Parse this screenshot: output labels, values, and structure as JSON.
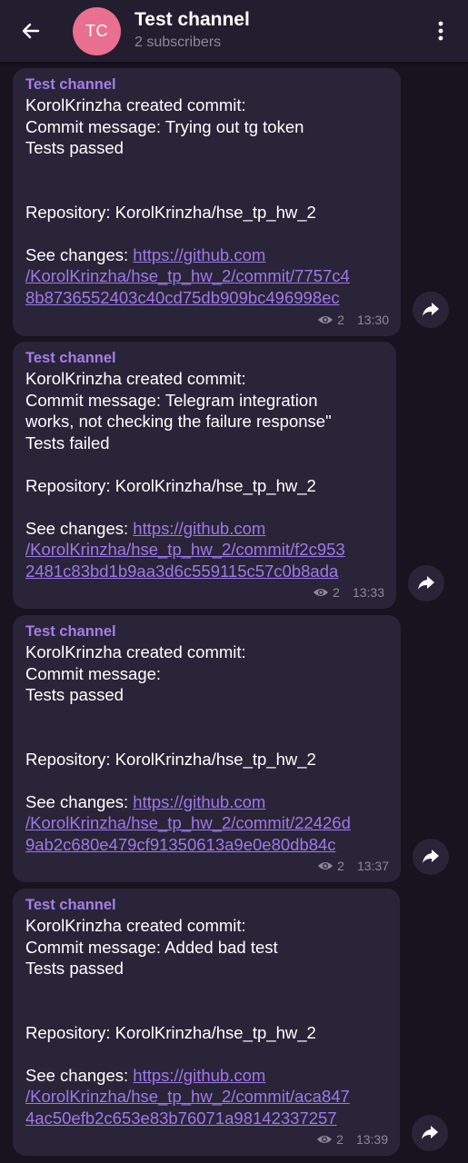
{
  "header": {
    "avatar_initials": "TC",
    "avatar_color": "#e9708e",
    "title": "Test channel",
    "subtitle": "2 subscribers"
  },
  "colors": {
    "background": "#17131f",
    "bubble": "#2a2438",
    "accent": "#a47ee8",
    "link": "#9f78ea"
  },
  "messages": [
    {
      "sender": "Test channel",
      "line1": "KorolKrinzha created commit:",
      "line2": "Commit message: Trying out tg token",
      "line3": "Tests passed",
      "line4": "",
      "repository": "Repository: KorolKrinzha/hse_tp_hw_2",
      "see_changes": "See changes: ",
      "link_part1": "https://github.com",
      "link_part2": "/KorolKrinzha/hse_tp_hw_2/commit/7757c4",
      "link_part3": "8b8736552403c40cd75db909bc496998ec",
      "views": "2",
      "time": "13:30"
    },
    {
      "sender": "Test channel",
      "line1": "KorolKrinzha created commit:",
      "line2": "Commit message: Telegram integration",
      "line3": "works, not checking the failure response\"",
      "line4": "Tests failed",
      "repository": "Repository: KorolKrinzha/hse_tp_hw_2",
      "see_changes": "See changes: ",
      "link_part1": "https://github.com",
      "link_part2": "/KorolKrinzha/hse_tp_hw_2/commit/f2c953",
      "link_part3": "2481c83bd1b9aa3d6c559115c57c0b8ada",
      "views": "2",
      "time": "13:33"
    },
    {
      "sender": "Test channel",
      "line1": "KorolKrinzha created commit:",
      "line2": "Commit message:",
      "line3": "Tests passed",
      "line4": "",
      "repository": "Repository: KorolKrinzha/hse_tp_hw_2",
      "see_changes": "See changes: ",
      "link_part1": "https://github.com",
      "link_part2": "/KorolKrinzha/hse_tp_hw_2/commit/22426d",
      "link_part3": "9ab2c680e479cf91350613a9e0e80db84c",
      "views": "2",
      "time": "13:37"
    },
    {
      "sender": "Test channel",
      "line1": "KorolKrinzha created commit:",
      "line2": "Commit message: Added bad test",
      "line3": "Tests passed",
      "line4": "",
      "repository": "Repository: KorolKrinzha/hse_tp_hw_2",
      "see_changes": "See changes: ",
      "link_part1": "https://github.com",
      "link_part2": "/KorolKrinzha/hse_tp_hw_2/commit/aca847",
      "link_part3": "4ac50efb2c653e83b76071a98142337257",
      "views": "2",
      "time": "13:39"
    }
  ]
}
